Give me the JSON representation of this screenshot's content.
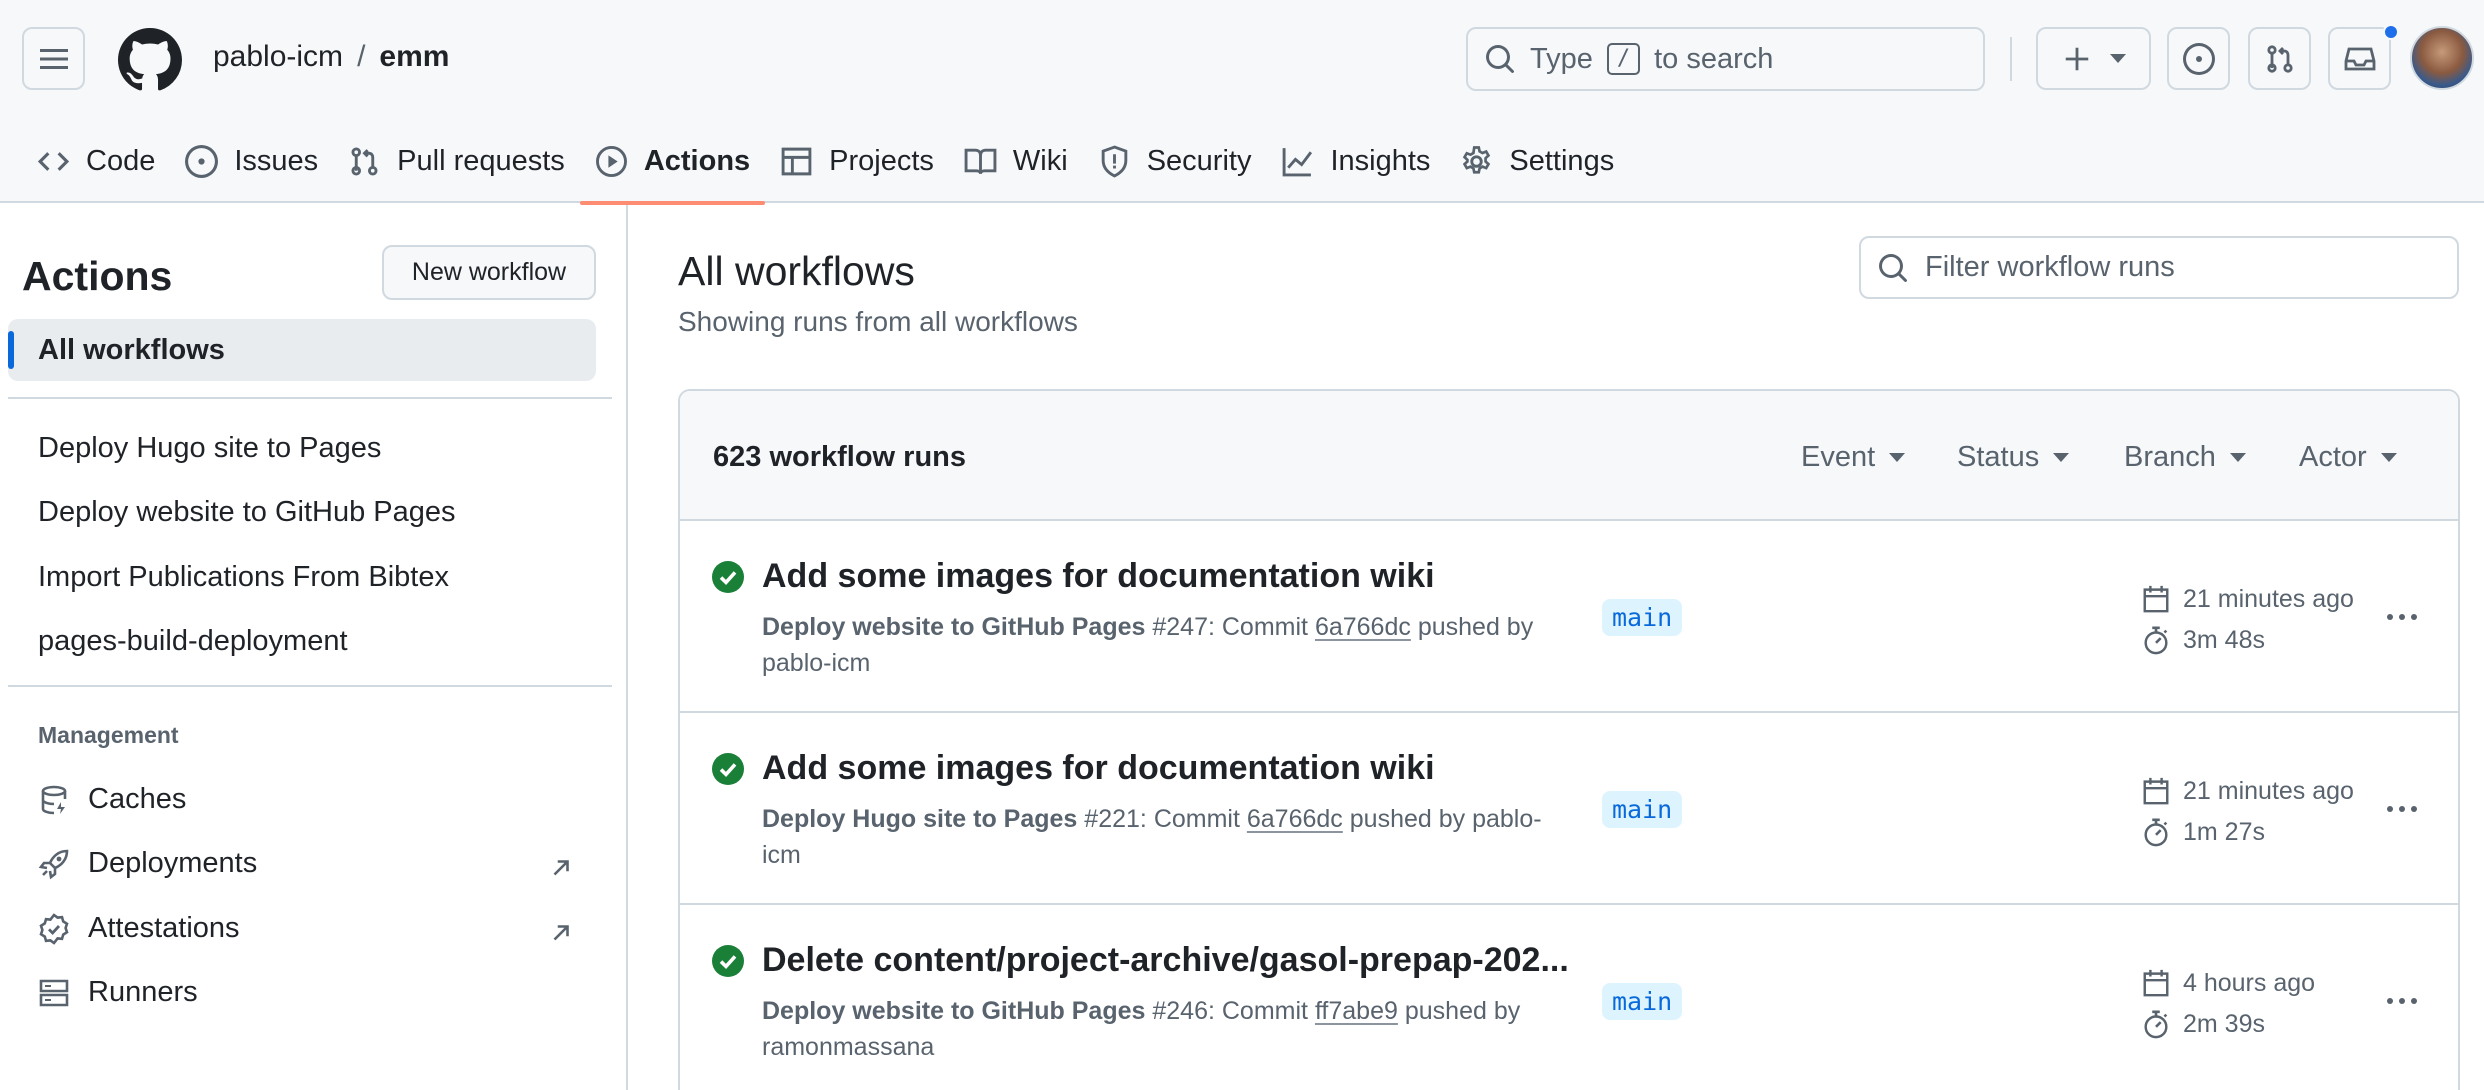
{
  "repo": {
    "owner": "pablo-icm",
    "separator": "/",
    "name": "emm"
  },
  "search": {
    "prefix": "Type",
    "key": "/",
    "suffix": "to search"
  },
  "tabs": [
    {
      "label": "Code",
      "icon": "code-icon"
    },
    {
      "label": "Issues",
      "icon": "issue-opened-icon"
    },
    {
      "label": "Pull requests",
      "icon": "git-pull-request-icon"
    },
    {
      "label": "Actions",
      "icon": "play-icon",
      "active": true
    },
    {
      "label": "Projects",
      "icon": "table-icon"
    },
    {
      "label": "Wiki",
      "icon": "book-icon"
    },
    {
      "label": "Security",
      "icon": "shield-icon"
    },
    {
      "label": "Insights",
      "icon": "graph-icon"
    },
    {
      "label": "Settings",
      "icon": "gear-icon"
    }
  ],
  "sidebar": {
    "title": "Actions",
    "new_workflow": "New workflow",
    "all_workflows": "All workflows",
    "workflows": [
      "Deploy Hugo site to Pages",
      "Deploy website to GitHub Pages",
      "Import Publications From Bibtex",
      "pages-build-deployment"
    ],
    "management_label": "Management",
    "management": [
      {
        "label": "Caches",
        "icon": "database-icon"
      },
      {
        "label": "Deployments",
        "icon": "rocket-icon",
        "external": true
      },
      {
        "label": "Attestations",
        "icon": "verified-icon",
        "external": true
      },
      {
        "label": "Runners",
        "icon": "server-icon"
      }
    ]
  },
  "main": {
    "title": "All workflows",
    "subtitle": "Showing runs from all workflows",
    "filter_placeholder": "Filter workflow runs",
    "runs_count": "623 workflow runs",
    "filters": [
      "Event",
      "Status",
      "Branch",
      "Actor"
    ],
    "runs": [
      {
        "title": "Add some images for documentation wiki",
        "workflow": "Deploy website to GitHub Pages",
        "number": "#247",
        "commit_label": ": Commit",
        "sha": "6a766dc",
        "pushed_by": "pushed by",
        "user": "pablo-icm",
        "branch": "main",
        "when": "21 minutes ago",
        "duration": "3m 48s",
        "status": "success"
      },
      {
        "title": "Add some images for documentation wiki",
        "workflow": "Deploy Hugo site to Pages",
        "number": "#221",
        "commit_label": ": Commit",
        "sha": "6a766dc",
        "pushed_by": "pushed by",
        "user": "pablo-icm",
        "branch": "main",
        "when": "21 minutes ago",
        "duration": "1m 27s",
        "status": "success"
      },
      {
        "title": "Delete content/project-archive/gasol-prepap-202...",
        "workflow": "Deploy website to GitHub Pages",
        "number": "#246",
        "commit_label": ": Commit",
        "sha": "ff7abe9",
        "pushed_by": "pushed by",
        "user": "ramonmassana",
        "branch": "main",
        "when": "4 hours ago",
        "duration": "2m 39s",
        "status": "success"
      }
    ]
  },
  "colors": {
    "accent": "#0969da",
    "success": "#1a7f37",
    "active_tab": "#fd8c73",
    "notification": "#1f6feb"
  }
}
